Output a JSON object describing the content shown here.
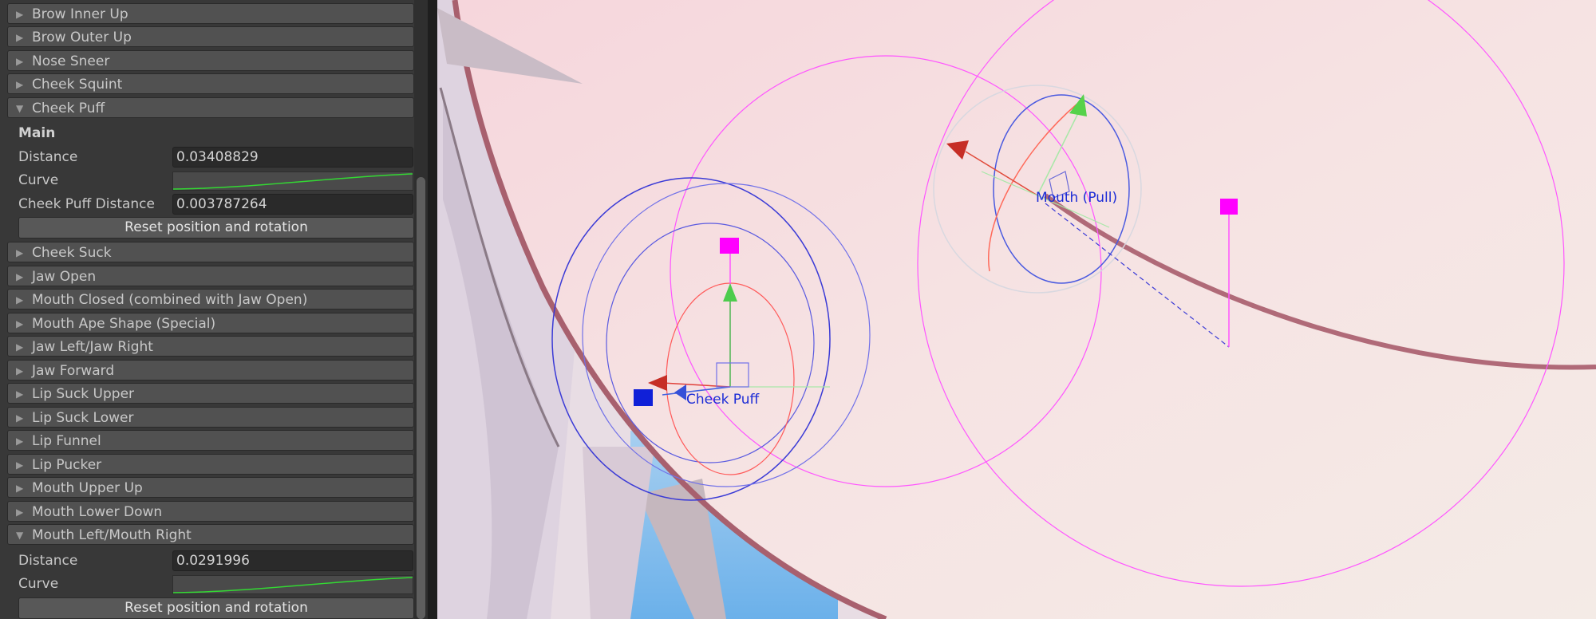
{
  "inspector": {
    "foldouts_top": [
      {
        "label": "Brow Inner Up",
        "expanded": false
      },
      {
        "label": "Brow Outer Up",
        "expanded": false
      },
      {
        "label": "Nose Sneer",
        "expanded": false
      },
      {
        "label": "Cheek Squint",
        "expanded": false
      },
      {
        "label": "Cheek Puff",
        "expanded": true
      }
    ],
    "cheek_puff": {
      "section_label": "Main",
      "distance_label": "Distance",
      "distance_value": "0.03408829",
      "curve_label": "Curve",
      "puff_distance_label": "Cheek Puff Distance",
      "puff_distance_value": "0.003787264",
      "reset_label": "Reset position and rotation"
    },
    "foldouts_mid": [
      {
        "label": "Cheek Suck",
        "expanded": false
      },
      {
        "label": "Jaw Open",
        "expanded": false
      },
      {
        "label": "Mouth Closed (combined with Jaw Open)",
        "expanded": false
      },
      {
        "label": "Mouth Ape Shape (Special)",
        "expanded": false
      },
      {
        "label": "Jaw Left/Jaw Right",
        "expanded": false
      },
      {
        "label": "Jaw Forward",
        "expanded": false
      },
      {
        "label": "Lip Suck Upper",
        "expanded": false
      },
      {
        "label": "Lip Suck Lower",
        "expanded": false
      },
      {
        "label": "Lip Funnel",
        "expanded": false
      },
      {
        "label": "Lip Pucker",
        "expanded": false
      },
      {
        "label": "Mouth Upper Up",
        "expanded": false
      },
      {
        "label": "Mouth Lower Down",
        "expanded": false
      },
      {
        "label": "Mouth Left/Mouth Right",
        "expanded": true
      }
    ],
    "mouth_left_right": {
      "distance_label": "Distance",
      "distance_value": "0.0291996",
      "curve_label": "Curve",
      "reset_label": "Reset position and rotation"
    }
  },
  "viewport": {
    "gizmo_labels": {
      "cheek_puff": "Cheek Puff",
      "mouth_pull": "Mouth (Pull)"
    }
  },
  "colors": {
    "panel_bg": "#383838",
    "foldout_bg": "#515151",
    "curve_line": "#33d933",
    "gizmo_blue": "#1b2bd6",
    "gizmo_magenta": "#ff00ff"
  }
}
